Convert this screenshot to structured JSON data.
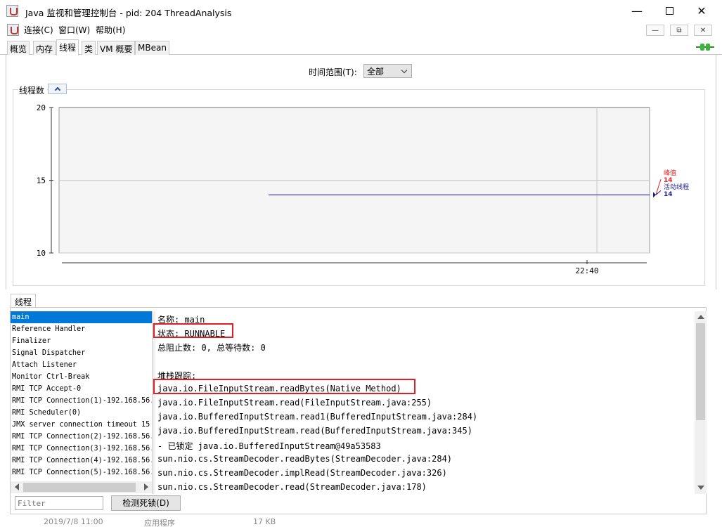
{
  "window": {
    "title": "Java 监视和管理控制台 - pid: 204 ThreadAnalysis",
    "minimize": "—",
    "close": "✕"
  },
  "menu": {
    "connect": "连接(C)",
    "window": "窗口(W)",
    "help": "帮助(H)",
    "mdi_min": "—",
    "mdi_restore": "⧉",
    "mdi_close": "✕"
  },
  "tabs": [
    {
      "label": "概览"
    },
    {
      "label": "内存"
    },
    {
      "label": "线程"
    },
    {
      "label": "类"
    },
    {
      "label": "VM 概要"
    },
    {
      "label": "MBean"
    }
  ],
  "active_tab": "线程",
  "time_range": {
    "label": "时间范围(T):",
    "selected": "全部"
  },
  "chart_data": {
    "type": "line",
    "title": "线程数",
    "x": [
      "22:40"
    ],
    "ylim": [
      10,
      20
    ],
    "yticks": [
      10,
      15,
      20
    ],
    "series": [
      {
        "name": "峰值",
        "value": 14,
        "color": "#e02020"
      },
      {
        "name": "活动线程",
        "value": 14,
        "color": "#1a1a8a"
      }
    ],
    "grid": true
  },
  "threads_section": {
    "tab_label": "线程",
    "items": [
      "main",
      "Reference Handler",
      "Finalizer",
      "Signal Dispatcher",
      "Attach Listener",
      "Monitor Ctrl-Break",
      "RMI TCP Accept-0",
      "RMI TCP Connection(1)-192.168.56.",
      "RMI Scheduler(0)",
      "JMX server connection timeout 15",
      "RMI TCP Connection(2)-192.168.56.",
      "RMI TCP Connection(3)-192.168.56.",
      "RMI TCP Connection(4)-192.168.56.",
      "RMI TCP Connection(5)-192.168.56."
    ],
    "selected": "main"
  },
  "detail": {
    "name": "名称: main",
    "state": "状态: RUNNABLE",
    "counts": "总阻止数: 0, 总等待数: 0",
    "stack_title": "堆栈跟踪:",
    "stack": [
      "java.io.FileInputStream.readBytes(Native Method)",
      "java.io.FileInputStream.read(FileInputStream.java:255)",
      "java.io.BufferedInputStream.read1(BufferedInputStream.java:284)",
      "java.io.BufferedInputStream.read(BufferedInputStream.java:345)",
      "   - 已锁定 java.io.BufferedInputStream@49a53583",
      "sun.nio.cs.StreamDecoder.readBytes(StreamDecoder.java:284)",
      "sun.nio.cs.StreamDecoder.implRead(StreamDecoder.java:326)",
      "sun.nio.cs.StreamDecoder.read(StreamDecoder.java:178)"
    ]
  },
  "filter": {
    "placeholder": "Filter"
  },
  "deadlock_button": "检测死锁(D)",
  "bottom_strip": {
    "date": "2019/7/8 11:00",
    "type": "应用程序",
    "size": "17 KB"
  }
}
